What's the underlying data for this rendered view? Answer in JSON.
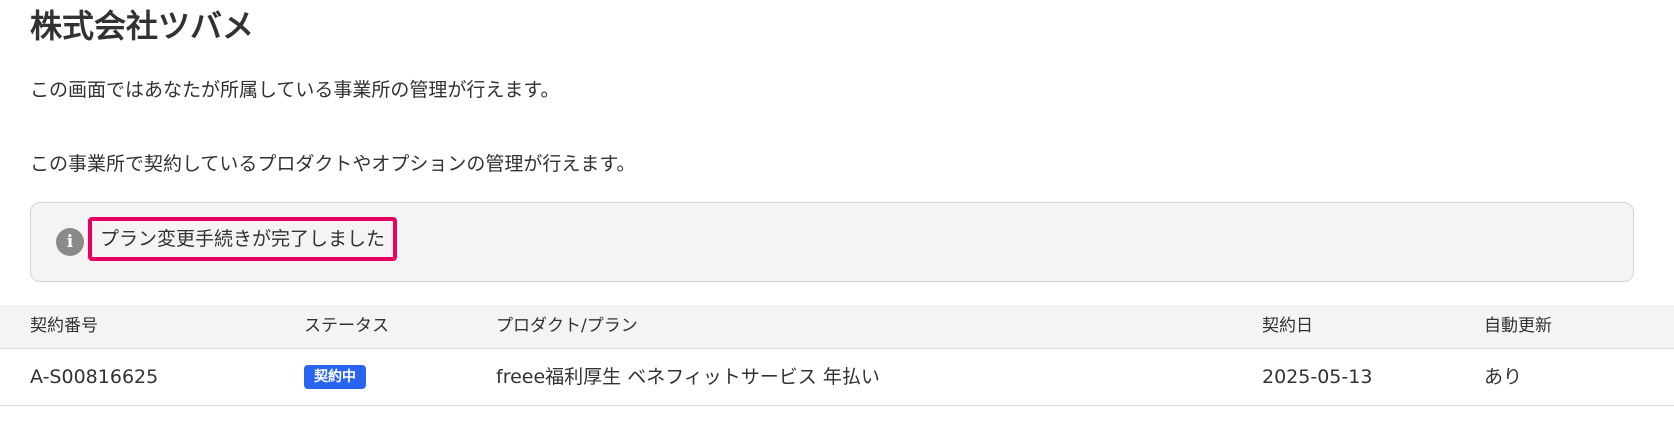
{
  "page": {
    "title": "株式会社ツバメ",
    "description_1": "この画面ではあなたが所属している事業所の管理が行えます。",
    "description_2": "この事業所で契約しているプロダクトやオプションの管理が行えます。"
  },
  "notice": {
    "icon": "info-icon",
    "icon_glyph": "i",
    "message": "プラン変更手続きが完了しました",
    "highlight_color": "#e60060"
  },
  "contracts_table": {
    "headers": {
      "contract_number": "契約番号",
      "status": "ステータス",
      "product_plan": "プロダクト/プラン",
      "contract_date": "契約日",
      "auto_renewal": "自動更新"
    },
    "rows": [
      {
        "contract_number": "A-S00816625",
        "status": "契約中",
        "status_color": "#2864f0",
        "product_plan": "freee福利厚生 ベネフィットサービス 年払い",
        "contract_date": "2025-05-13",
        "auto_renewal": "あり"
      }
    ]
  }
}
